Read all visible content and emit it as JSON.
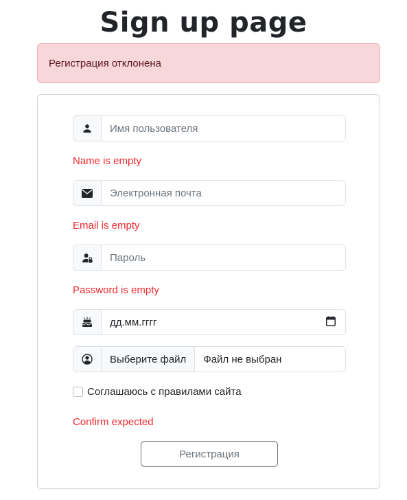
{
  "header": {
    "title": "Sign up page"
  },
  "alert": {
    "message": "Регистрация отклонена"
  },
  "form": {
    "username": {
      "placeholder": "Имя пользователя",
      "value": "",
      "error": "Name is empty",
      "icon": "person-icon"
    },
    "email": {
      "placeholder": "Электронная почта",
      "value": "",
      "error": "Email is empty",
      "icon": "envelope-icon"
    },
    "password": {
      "placeholder": "Пароль",
      "value": "",
      "error": "Password is empty",
      "icon": "person-lock-icon"
    },
    "birthdate": {
      "placeholder": "дд.мм.гггг",
      "icon": "cake-icon",
      "calendar_icon": "calendar-icon"
    },
    "avatar": {
      "button_label": "Выберите файл",
      "status": "Файл не выбран",
      "icon": "person-circle-icon"
    },
    "agree": {
      "label": "Соглашаюсь с правилами сайта",
      "checked": false,
      "error": "Confirm expected"
    },
    "submit_label": "Регистрация"
  },
  "colors": {
    "alert_bg": "#f8d7da",
    "alert_text": "#58151c",
    "error_text": "#f0282d",
    "border": "#dee2e6",
    "button_text": "#6c757d"
  }
}
